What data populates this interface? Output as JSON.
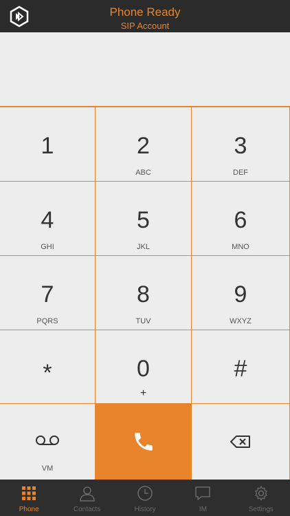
{
  "header": {
    "status": "Phone Ready",
    "account": "SIP Account",
    "logo_icon": "app-logo-icon"
  },
  "keys": [
    {
      "digit": "1",
      "letters": ""
    },
    {
      "digit": "2",
      "letters": "ABC"
    },
    {
      "digit": "3",
      "letters": "DEF"
    },
    {
      "digit": "4",
      "letters": "GHI"
    },
    {
      "digit": "5",
      "letters": "JKL"
    },
    {
      "digit": "6",
      "letters": "MNO"
    },
    {
      "digit": "7",
      "letters": "PQRS"
    },
    {
      "digit": "8",
      "letters": "TUV"
    },
    {
      "digit": "9",
      "letters": "WXYZ"
    },
    {
      "digit": "*",
      "letters": ""
    },
    {
      "digit": "0",
      "letters": "+"
    },
    {
      "digit": "#",
      "letters": ""
    }
  ],
  "actions": {
    "voicemail_label": "VM",
    "voicemail_icon": "voicemail-icon",
    "call_icon": "phone-icon",
    "delete_icon": "backspace-icon"
  },
  "tabs": [
    {
      "label": "Phone",
      "icon": "keypad-icon",
      "active": true
    },
    {
      "label": "Contacts",
      "icon": "person-icon",
      "active": false
    },
    {
      "label": "History",
      "icon": "clock-icon",
      "active": false
    },
    {
      "label": "IM",
      "icon": "chat-bubble-icon",
      "active": false
    },
    {
      "label": "Settings",
      "icon": "gear-icon",
      "active": false
    }
  ],
  "colors": {
    "accent": "#e8852c",
    "keypad_bg": "#ededed",
    "bar_bg": "#2b2b2b"
  }
}
